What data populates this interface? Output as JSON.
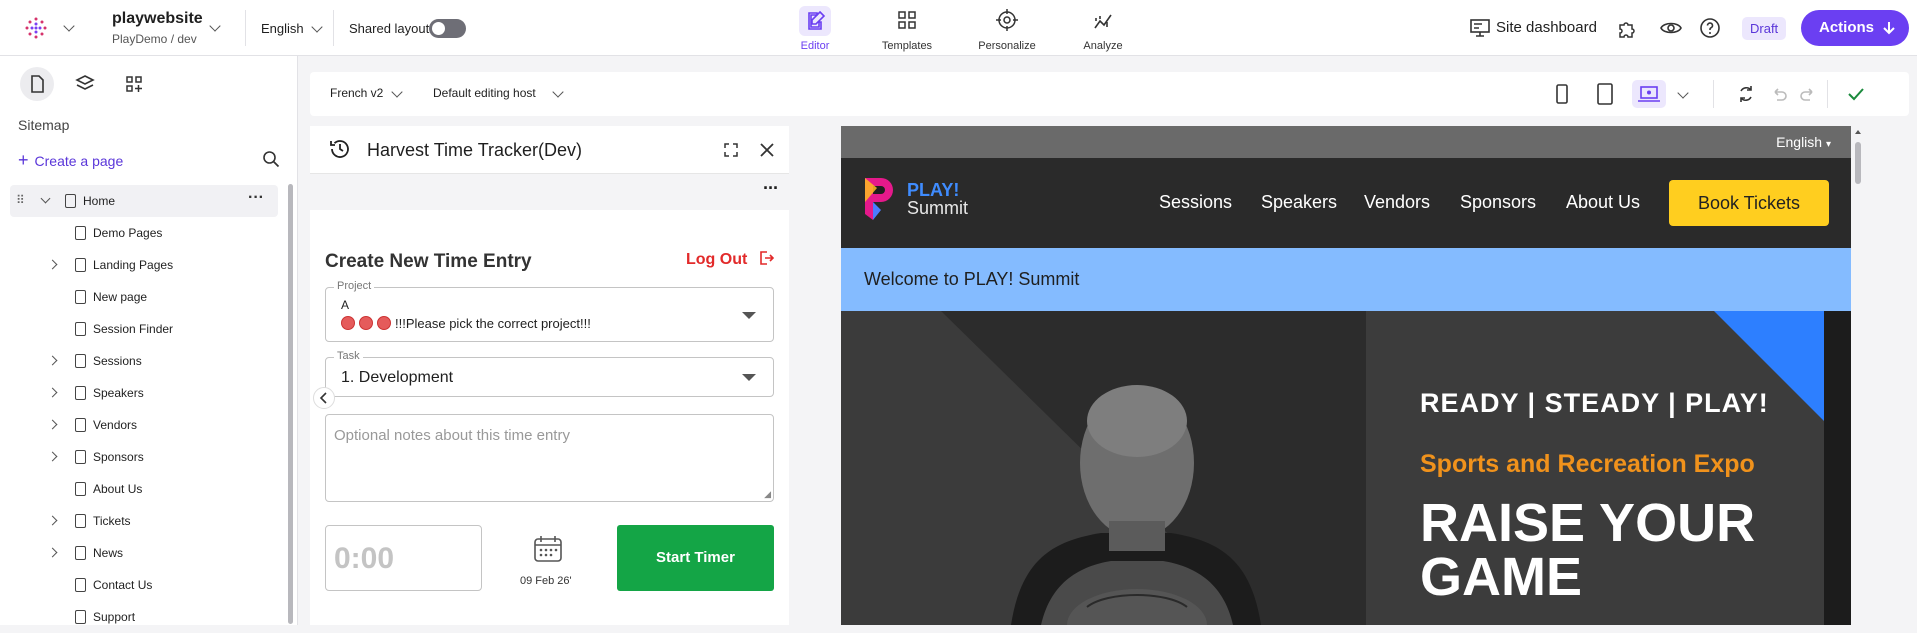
{
  "topbar": {
    "site_name": "playwebsite",
    "site_path": "PlayDemo / dev",
    "language": "English",
    "shared_layout_label": "Shared layout",
    "tabs": [
      {
        "label": "Editor",
        "icon": "pen-icon"
      },
      {
        "label": "Templates",
        "icon": "grid-icon"
      },
      {
        "label": "Personalize",
        "icon": "target-icon"
      },
      {
        "label": "Analyze",
        "icon": "chart-icon"
      }
    ],
    "site_dashboard_label": "Site dashboard",
    "status_badge": "Draft",
    "actions_label": "Actions"
  },
  "sidebar": {
    "title": "Sitemap",
    "create_page_label": "Create a page",
    "items": [
      {
        "label": "Home",
        "expandable": true
      },
      {
        "label": "Demo Pages",
        "expandable": false
      },
      {
        "label": "Landing Pages",
        "expandable": true
      },
      {
        "label": "New page",
        "expandable": false
      },
      {
        "label": "Session Finder",
        "expandable": false
      },
      {
        "label": "Sessions",
        "expandable": true
      },
      {
        "label": "Speakers",
        "expandable": true
      },
      {
        "label": "Vendors",
        "expandable": true
      },
      {
        "label": "Sponsors",
        "expandable": true
      },
      {
        "label": "About Us",
        "expandable": false
      },
      {
        "label": "Tickets",
        "expandable": true
      },
      {
        "label": "News",
        "expandable": true
      },
      {
        "label": "Contact Us",
        "expandable": false
      },
      {
        "label": "Support",
        "expandable": false
      }
    ]
  },
  "canvas_toolbar": {
    "variant": "French v2",
    "host": "Default editing host"
  },
  "panel": {
    "title": "Harvest Time Tracker(Dev)",
    "form_title": "Create New Time Entry",
    "logout_label": "Log Out",
    "project_legend": "Project",
    "project_prefix": "A",
    "project_value": "!!!Please pick the correct project!!!",
    "task_legend": "Task",
    "task_value": "1. Development",
    "notes_placeholder": "Optional notes about this time entry",
    "timer_value": "0:00",
    "date_label": "09 Feb 26'",
    "start_button": "Start Timer"
  },
  "preview": {
    "language": "English",
    "brand_top": "PLAY!",
    "brand_bottom": "Summit",
    "menu": [
      "Sessions",
      "Speakers",
      "Vendors",
      "Sponsors",
      "About Us"
    ],
    "book_button": "Book Tickets",
    "welcome": "Welcome to PLAY! Summit",
    "hero_tagline": "READY | STEADY | PLAY!",
    "hero_subtitle": "Sports and Recreation Expo",
    "hero_title": "RAISE YOUR GAME"
  },
  "colors": {
    "accent": "#6b3ff2",
    "start_button": "#14a546",
    "logout": "#e22a2a",
    "book_button": "#ffce1f",
    "welcome_banner": "#84bbff",
    "expo_orange": "#f0921c"
  }
}
